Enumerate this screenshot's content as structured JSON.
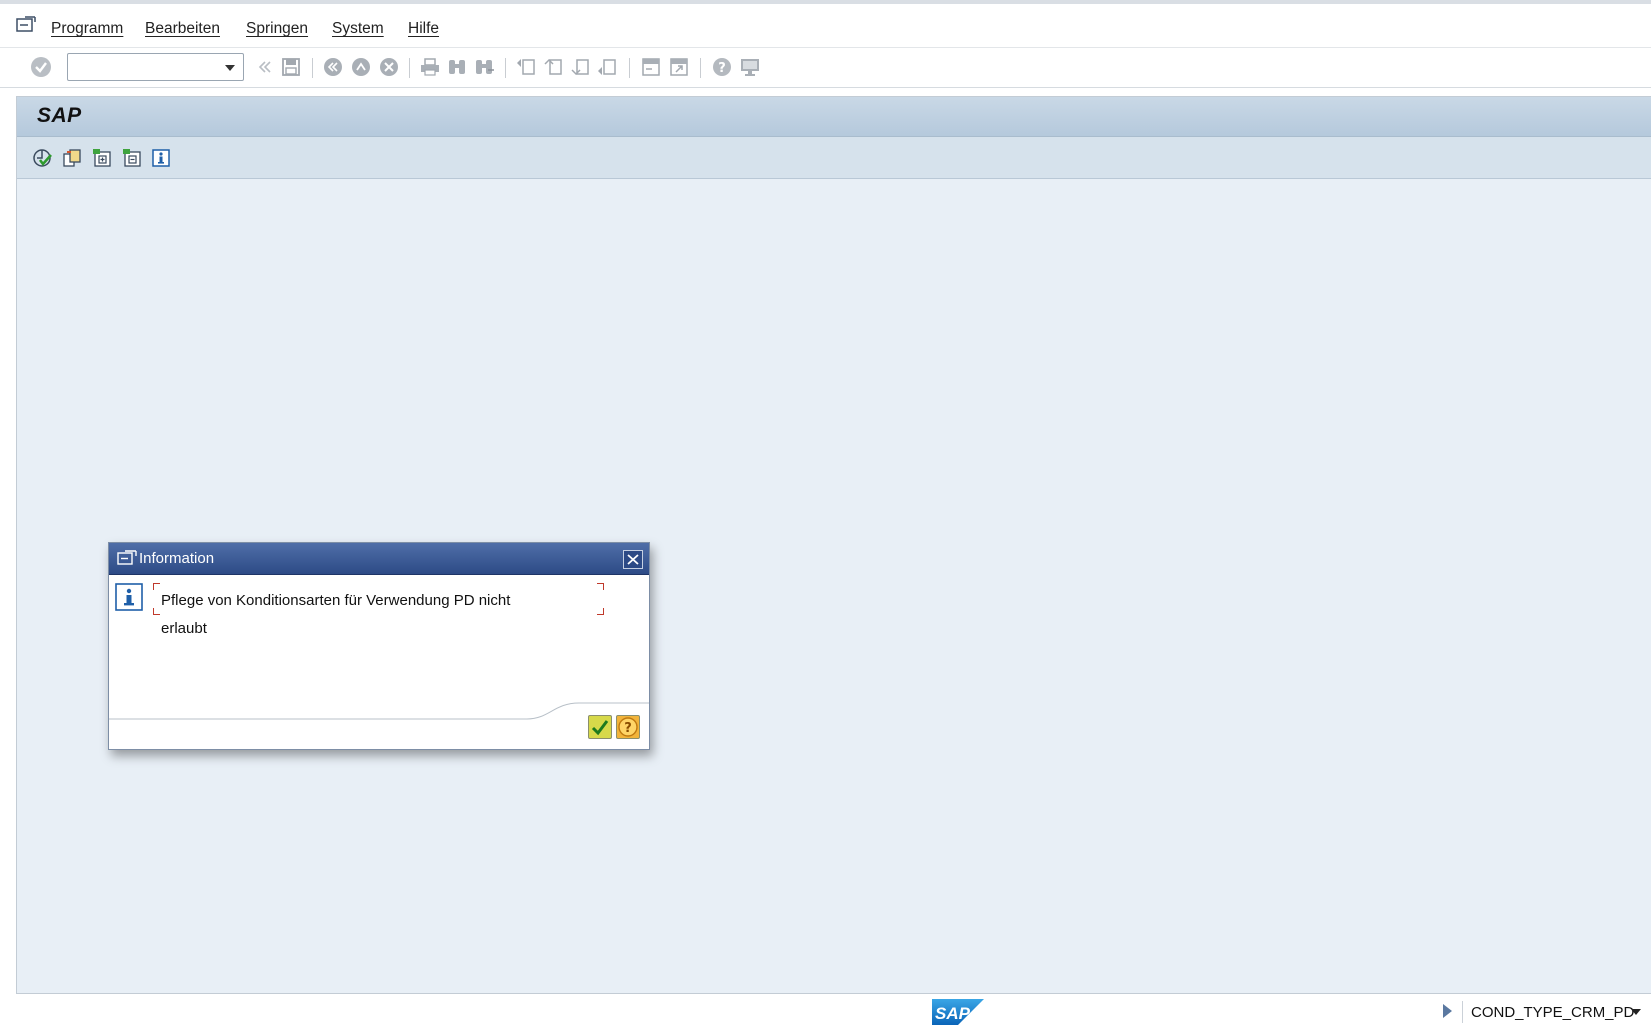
{
  "menubar": {
    "items": [
      {
        "label": "Programm"
      },
      {
        "label": "Bearbeiten"
      },
      {
        "label": "Springen"
      },
      {
        "label": "System"
      },
      {
        "label": "Hilfe"
      }
    ]
  },
  "toolbar": {
    "command_field": {
      "value": "",
      "placeholder": ""
    },
    "buttons": [
      "enter-icon",
      "back-icon",
      "save-icon",
      "back-nav-icon",
      "exit-icon",
      "cancel-icon",
      "print-icon",
      "find-icon",
      "find-next-icon",
      "first-page-icon",
      "previous-page-icon",
      "next-page-icon",
      "last-page-icon",
      "new-session-icon",
      "shortcut-icon",
      "help-icon",
      "layout-icon"
    ]
  },
  "window": {
    "title": "SAP",
    "app_toolbar_icons": [
      "execute-icon",
      "copy-icon",
      "expand-icon",
      "collapse-icon",
      "info-icon"
    ]
  },
  "dialog": {
    "title": "Information",
    "message_line1": "Pflege von Konditionsarten für Verwendung PD nicht",
    "message_line2": "erlaubt",
    "confirm_icon": "checkmark-icon",
    "help_icon": "question-icon"
  },
  "statusbar": {
    "logo_text": "SAP",
    "system": "COND_TYPE_CRM_PD"
  },
  "colors": {
    "frame_bg": "#e8eff6",
    "dialog_title_bg": "#2d4b86",
    "confirm_button": "#d7d94a",
    "help_button": "#f2b43a"
  }
}
